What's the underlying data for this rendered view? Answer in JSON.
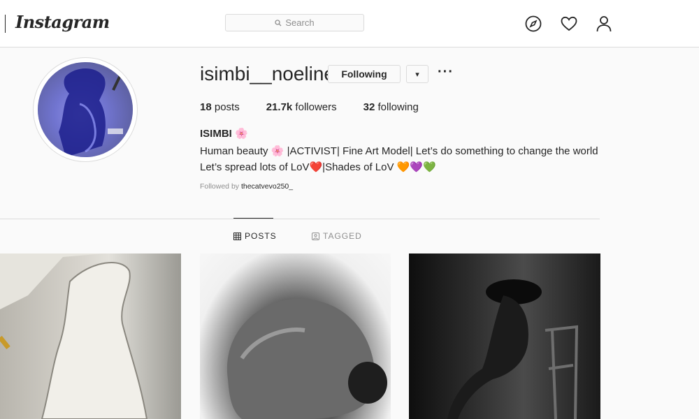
{
  "nav": {
    "logo": "Instagram",
    "search_placeholder": "Search",
    "icons": [
      "compass-icon",
      "heart-icon",
      "profile-icon"
    ]
  },
  "profile": {
    "username": "isimbi__noeline",
    "following_button": "Following",
    "dropdown_glyph": "▾",
    "more_glyph": "···",
    "stats": {
      "posts_count": "18",
      "posts_label": " posts",
      "followers_count": "21.7k",
      "followers_label": " followers",
      "following_count": "32",
      "following_label": " following"
    },
    "full_name": "ISIMBI 🌸",
    "bio_line1": "Human beauty 🌸 |ACTIVIST| Fine Art Model| Let’s do something to change the world",
    "bio_line2": "Let’s spread lots of LoV❤️|Shades of LoV 🧡💜💚",
    "followed_by_prefix": "Followed by ",
    "followed_by_user": "thecatvevo250_"
  },
  "tabs": [
    {
      "label": "POSTS",
      "active": true
    },
    {
      "label": "TAGGED",
      "active": false
    }
  ],
  "posts": [
    {
      "description": "pencil drawing"
    },
    {
      "description": "black and white photo"
    },
    {
      "description": "black and white photo"
    }
  ],
  "colors": {
    "border": "#dbdbdb",
    "text": "#262626",
    "muted": "#8e8e8e",
    "background": "#fafafa"
  }
}
